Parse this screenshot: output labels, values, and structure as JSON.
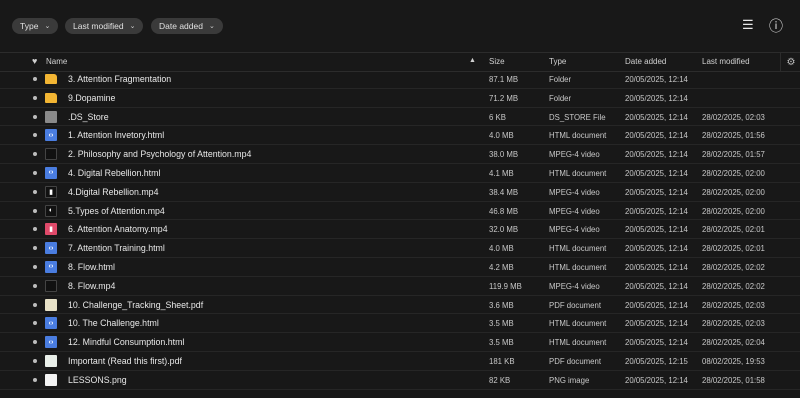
{
  "toolbar": {
    "filters": [
      {
        "label": "Type"
      },
      {
        "label": "Last modified"
      },
      {
        "label": "Date added"
      }
    ],
    "chevron": "⌄",
    "list_icon": "☰",
    "info_icon": "ⓘ"
  },
  "columns": {
    "fav_icon": "♥",
    "name": "Name",
    "sort_icon": "▲",
    "size": "Size",
    "type": "Type",
    "date_added": "Date added",
    "last_modified": "Last modified",
    "settings_icon": "⚙"
  },
  "files": [
    {
      "icon": "folder",
      "glyph": "",
      "name": "3. Attention Fragmentation",
      "size": "87.1 MB",
      "type": "Folder",
      "added": "20/05/2025, 12:14",
      "modified": ""
    },
    {
      "icon": "folder",
      "glyph": "",
      "name": "9.Dopamine",
      "size": "71.2 MB",
      "type": "Folder",
      "added": "20/05/2025, 12:14",
      "modified": ""
    },
    {
      "icon": "file",
      "glyph": "",
      "name": ".DS_Store",
      "size": "6 KB",
      "type": "DS_STORE File",
      "added": "20/05/2025, 12:14",
      "modified": "28/02/2025, 02:03"
    },
    {
      "icon": "html",
      "glyph": "‹›",
      "name": "1. Attention Invetory.html",
      "size": "4.0 MB",
      "type": "HTML document",
      "added": "20/05/2025, 12:14",
      "modified": "28/02/2025, 01:56"
    },
    {
      "icon": "video",
      "glyph": "",
      "name": "2. Philosophy and Psychology of Attention.mp4",
      "size": "38.0 MB",
      "type": "MPEG-4 video",
      "added": "20/05/2025, 12:14",
      "modified": "28/02/2025, 01:57"
    },
    {
      "icon": "html",
      "glyph": "‹›",
      "name": "4. Digital Rebellion.html",
      "size": "4.1 MB",
      "type": "HTML document",
      "added": "20/05/2025, 12:14",
      "modified": "28/02/2025, 02:00"
    },
    {
      "icon": "video",
      "glyph": "▮",
      "name": "4.Digital Rebellion.mp4",
      "size": "38.4 MB",
      "type": "MPEG-4 video",
      "added": "20/05/2025, 12:14",
      "modified": "28/02/2025, 02:00"
    },
    {
      "icon": "video",
      "glyph": "◐",
      "name": "5.Types of Attention.mp4",
      "size": "46.8 MB",
      "type": "MPEG-4 video",
      "added": "20/05/2025, 12:14",
      "modified": "28/02/2025, 02:00"
    },
    {
      "icon": "anatomy",
      "glyph": "▮",
      "name": "6. Attention Anatomy.mp4",
      "size": "32.0 MB",
      "type": "MPEG-4 video",
      "added": "20/05/2025, 12:14",
      "modified": "28/02/2025, 02:01"
    },
    {
      "icon": "html",
      "glyph": "‹›",
      "name": "7. Attention Training.html",
      "size": "4.0 MB",
      "type": "HTML document",
      "added": "20/05/2025, 12:14",
      "modified": "28/02/2025, 02:01"
    },
    {
      "icon": "html",
      "glyph": "‹›",
      "name": "8. Flow.html",
      "size": "4.2 MB",
      "type": "HTML document",
      "added": "20/05/2025, 12:14",
      "modified": "28/02/2025, 02:02"
    },
    {
      "icon": "video",
      "glyph": "",
      "name": "8. Flow.mp4",
      "size": "119.9 MB",
      "type": "MPEG-4 video",
      "added": "20/05/2025, 12:14",
      "modified": "28/02/2025, 02:02"
    },
    {
      "icon": "pdf",
      "glyph": "",
      "name": "10. Challenge_Tracking_Sheet.pdf",
      "size": "3.6 MB",
      "type": "PDF document",
      "added": "20/05/2025, 12:14",
      "modified": "28/02/2025, 02:03"
    },
    {
      "icon": "html",
      "glyph": "‹›",
      "name": "10. The Challenge.html",
      "size": "3.5 MB",
      "type": "HTML document",
      "added": "20/05/2025, 12:14",
      "modified": "28/02/2025, 02:03"
    },
    {
      "icon": "html",
      "glyph": "‹›",
      "name": "12. Mindful Consumption.html",
      "size": "3.5 MB",
      "type": "HTML document",
      "added": "20/05/2025, 12:14",
      "modified": "28/02/2025, 02:04"
    },
    {
      "icon": "pdf2",
      "glyph": "",
      "name": "Important (Read this first).pdf",
      "size": "181 KB",
      "type": "PDF document",
      "added": "20/05/2025, 12:15",
      "modified": "08/02/2025, 19:53"
    },
    {
      "icon": "png",
      "glyph": "",
      "name": "LESSONS.png",
      "size": "82 KB",
      "type": "PNG image",
      "added": "20/05/2025, 12:14",
      "modified": "28/02/2025, 01:58"
    }
  ]
}
